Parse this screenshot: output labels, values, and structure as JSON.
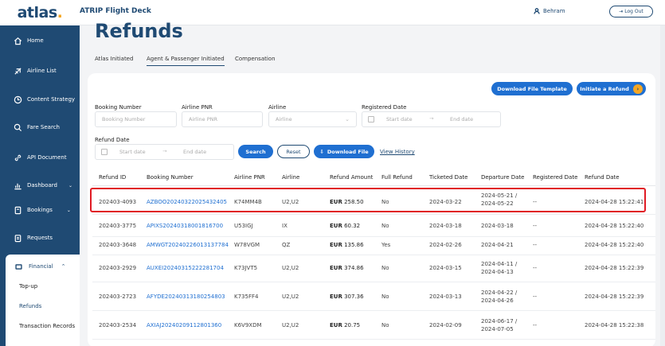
{
  "brand": {
    "logo_main": "atlas",
    "logo_dot": "."
  },
  "header": {
    "app_title": "ATRIP Flight Deck",
    "user_name": "Behram",
    "logout_label": "Log Out"
  },
  "sidebar": {
    "items": [
      {
        "label": "Home"
      },
      {
        "label": "Airline List"
      },
      {
        "label": "Content Strategy"
      },
      {
        "label": "Fare Search"
      },
      {
        "label": "API Document"
      },
      {
        "label": "Dashboard"
      },
      {
        "label": "Bookings"
      },
      {
        "label": "Requests"
      }
    ],
    "financial": {
      "label": "Financial",
      "sub_items": [
        {
          "label": "Top-up"
        },
        {
          "label": "Refunds"
        },
        {
          "label": "Transaction Records"
        }
      ]
    }
  },
  "page": {
    "title": "Refunds",
    "tabs": [
      {
        "label": "Atlas Initiated"
      },
      {
        "label": "Agent & Passenger Initiated"
      },
      {
        "label": "Compensation"
      }
    ]
  },
  "actions": {
    "download_template": "Download File Template",
    "initiate_refund": "Initiate a Refund"
  },
  "filters": {
    "booking_number": {
      "label": "Booking Number",
      "placeholder": "Booking Number"
    },
    "airline_pnr": {
      "label": "Airline PNR",
      "placeholder": "Airline PNR"
    },
    "airline": {
      "label": "Airline",
      "placeholder": "Airline"
    },
    "registered_date": {
      "label": "Registered Date",
      "start": "Start date",
      "end": "End date"
    },
    "refund_date": {
      "label": "Refund Date",
      "start": "Start date",
      "end": "End date"
    },
    "search_label": "Search",
    "reset_label": "Reset",
    "download_file_label": "Download File",
    "view_history_label": "View History"
  },
  "table": {
    "columns": [
      "Refund ID",
      "Booking Number",
      "Airline PNR",
      "Airline",
      "Refund Amount",
      "Full Refund",
      "Ticketed Date",
      "Departure Date",
      "Registered Date",
      "Refund Date"
    ],
    "rows": [
      {
        "refund_id": "202403-4093",
        "booking": "AZBOO20240322025432405",
        "pnr": "K74MM4B",
        "airline": "U2,U2",
        "currency": "EUR",
        "amount": "258.50",
        "full_refund": "No",
        "ticketed": "2024-03-22",
        "departure": "2024-05-21 / 2024-05-22",
        "registered": "--",
        "refund_date": "2024-04-28 15:22:41"
      },
      {
        "refund_id": "202403-3775",
        "booking": "APIXS20240318001816700",
        "pnr": "U53IGJ",
        "airline": "IX",
        "currency": "EUR",
        "amount": "60.32",
        "full_refund": "No",
        "ticketed": "2024-03-18",
        "departure": "2024-03-18",
        "registered": "--",
        "refund_date": "2024-04-28 15:22:40"
      },
      {
        "refund_id": "202403-3648",
        "booking": "AMWGT20240226013137784",
        "pnr": "W78VGM",
        "airline": "QZ",
        "currency": "EUR",
        "amount": "135.86",
        "full_refund": "Yes",
        "ticketed": "2024-02-26",
        "departure": "2024-04-21",
        "registered": "--",
        "refund_date": "2024-04-28 15:22:40"
      },
      {
        "refund_id": "202403-2929",
        "booking": "AUXEI20240315222281704",
        "pnr": "K73JVT5",
        "airline": "U2,U2",
        "currency": "EUR",
        "amount": "374.86",
        "full_refund": "No",
        "ticketed": "2024-03-15",
        "departure": "2024-04-11 / 2024-04-13",
        "registered": "--",
        "refund_date": "2024-04-28 15:22:39"
      },
      {
        "refund_id": "202403-2723",
        "booking": "AFYDE20240313180254803",
        "pnr": "K735FF4",
        "airline": "U2,U2",
        "currency": "EUR",
        "amount": "307.36",
        "full_refund": "No",
        "ticketed": "2024-03-13",
        "departure": "2024-04-22 / 2024-04-26",
        "registered": "--",
        "refund_date": "2024-04-28 15:22:39"
      },
      {
        "refund_id": "202403-2534",
        "booking": "AXIAJ20240209112801360",
        "pnr": "K6V9XDM",
        "airline": "U2,U2",
        "currency": "EUR",
        "amount": "20.75",
        "full_refund": "No",
        "ticketed": "2024-02-09",
        "departure": "2024-06-17 / 2024-07-05",
        "registered": "--",
        "refund_date": "2024-04-28 15:22:38"
      }
    ]
  },
  "colors": {
    "navy": "#1f4a73",
    "accent_blue": "#1f6fd1",
    "accent_yellow": "#f4a623",
    "highlight_red": "#e01b24"
  }
}
